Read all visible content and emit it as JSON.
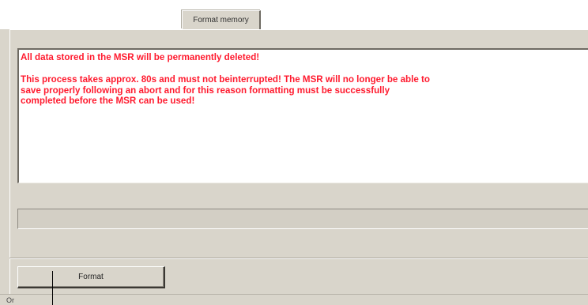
{
  "tab": {
    "label": "Format memory"
  },
  "message": {
    "lines": [
      "All data stored in the MSR will be permanently deleted!",
      "",
      "This process takes approx. 80s and must not beinterrupted! The MSR will no longer be able to",
      "save properly following an abort and for this reason formatting must be successfully",
      "completed before the MSR can be used!"
    ],
    "color": "#ff1a2e"
  },
  "progress": {
    "value": 0
  },
  "actions": {
    "format_label": "Format"
  },
  "status_bar": {
    "text": "Or"
  }
}
